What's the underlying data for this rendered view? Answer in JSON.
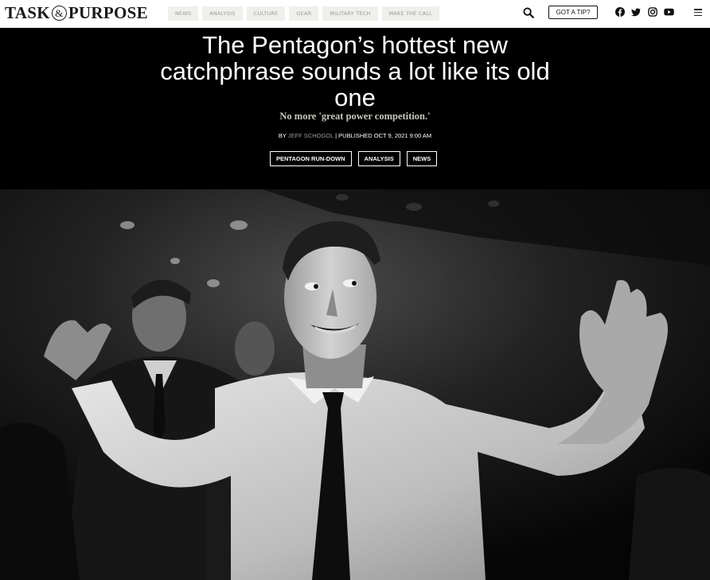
{
  "header": {
    "logo": {
      "left": "TASK",
      "amp": "&",
      "right": "PURPOSE"
    },
    "nav": [
      "NEWS",
      "ANALYSIS",
      "CULTURE",
      "GEAR",
      "MILITARY TECH",
      "MAKE THE CALL"
    ],
    "tip_button": "GOT A TIP?",
    "icons": [
      "search-icon",
      "facebook-icon",
      "twitter-icon",
      "instagram-icon",
      "youtube-icon",
      "menu-icon"
    ]
  },
  "article": {
    "headline": [
      "The Pentagon’s hottest new",
      "catchphrase sounds a lot like its old",
      "one"
    ],
    "dek": "No more 'great power competition.'",
    "byline": {
      "by": "BY",
      "author": "JEFF SCHOGOL",
      "published": "| PUBLISHED OCT 9, 2021 9:00 AM"
    },
    "tags": [
      "PENTAGON RUN-DOWN",
      "ANALYSIS",
      "NEWS"
    ]
  },
  "colors": {
    "background": "#000000",
    "nav_bg": "#efefeb",
    "nav_text": "#9a9a92",
    "dek": "#c8c8bc"
  }
}
